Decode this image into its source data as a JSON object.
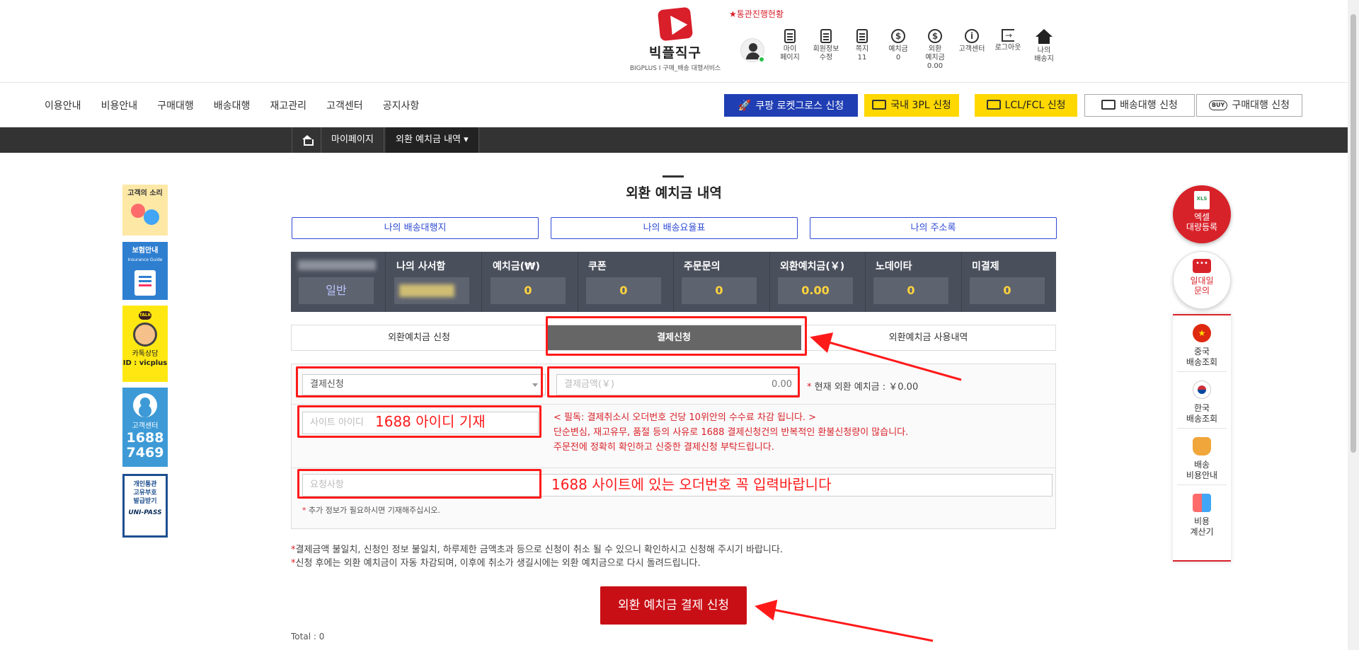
{
  "brand": {
    "name": "빅플직구",
    "tagline": "BIGPLUS I 구매_배송 대행서비스",
    "accent_color": "#d81f2a"
  },
  "header": {
    "customs_link": "★통관진행현황",
    "utility_nav": [
      {
        "label": "마이\n페이지",
        "icon": "id-card-icon"
      },
      {
        "label": "회원정보\n수정",
        "icon": "id-card-icon"
      },
      {
        "label": "쪽지\n11",
        "icon": "document-icon"
      },
      {
        "label": "예치금\n0",
        "icon": "dollar-icon"
      },
      {
        "label": "외환\n예치금\n0.00",
        "icon": "dollar-icon"
      },
      {
        "label": "고객센터",
        "icon": "info-icon"
      },
      {
        "label": "로그아웃",
        "icon": "logout-icon"
      },
      {
        "label": "나의\n배송지",
        "icon": "home-icon"
      }
    ]
  },
  "gnb": {
    "items": [
      "이용안내",
      "비용안내",
      "구매대행",
      "배송대행",
      "재고관리",
      "고객센터",
      "공지사항"
    ]
  },
  "service_buttons": [
    {
      "label": "쿠팡 로켓그로스 신청",
      "style": "blue"
    },
    {
      "label": "국내 3PL 신청",
      "style": "yellow"
    },
    {
      "label": "LCL/FCL 신청",
      "style": "yellow"
    },
    {
      "label": "배송대행 신청",
      "style": "white"
    },
    {
      "label": "구매대행 신청",
      "style": "white"
    }
  ],
  "breadcrumb": {
    "items": [
      "마이페이지",
      "외환 예치금 내역 ▾"
    ]
  },
  "left_banners": {
    "voice": "고객의 소리",
    "insurance": "보험안내",
    "insurance_sub": "Insurance Guide",
    "kakao_talk": "TALK",
    "kakao_label": "카톡상담",
    "kakao_id": "ID : vicplus",
    "cs_label": "고객센터",
    "cs_tel": "1688\n7469",
    "unipass_text": "개인통관\n고유부호\n발급받기",
    "unipass_brand": "UNI-PASS"
  },
  "right_float": {
    "excel": "엑셀\n대량등록",
    "excel_badge": "XLS",
    "chat": "일대일\n문의",
    "chat_badge": "•••",
    "china_badge": "★",
    "items": [
      {
        "label": "중국\n배송조회",
        "icon": "china-flag-icon"
      },
      {
        "label": "한국\n배송조회",
        "icon": "korea-flag-icon"
      },
      {
        "label": "배송\n비용안내",
        "icon": "money-bag-icon"
      },
      {
        "label": "비용\n계산기",
        "icon": "calculator-icon"
      }
    ]
  },
  "main": {
    "title": "외환 예치금 내역",
    "quick_links": [
      "나의 배송대행지",
      "나의 배송요율표",
      "나의 주소록"
    ],
    "summary": {
      "grade": "일반",
      "columns": [
        {
          "label": "나의 사서함",
          "value": ""
        },
        {
          "label": "예치금(₩)",
          "value": "0"
        },
        {
          "label": "쿠폰",
          "value": "0"
        },
        {
          "label": "주문문의",
          "value": "0"
        },
        {
          "label": "외환예치금(￥)",
          "value": "0.00"
        },
        {
          "label": "노데이타",
          "value": "0"
        },
        {
          "label": "미결제",
          "value": "0"
        }
      ]
    },
    "tabs": [
      "외환예치금 신청",
      "결제신청",
      "외환예치금 사용내역"
    ],
    "active_tab": 1,
    "form": {
      "type_select": "결제신청",
      "amount_placeholder": "결제금액(￥)",
      "amount_value": "0.00",
      "current_balance": "현재 외환 예치금 : ￥0.00",
      "site_id_placeholder": "사이트 아이디",
      "notice": [
        "< 필독: 결제취소시 오더번호 건당 10위안의 수수료 차감 됩니다. >",
        "단순변심, 재고유무, 품절 등의 사유로 1688 결제신청건의 반복적인 환불신청량이 많습니다.",
        "주문전에 정확히 확인하고 신중한 결제신청 부탁드립니다."
      ],
      "request_placeholder": "요청사항",
      "request_help": "추가 정보가 필요하시면 기재해주십시오."
    },
    "annotations": {
      "site_id": "1688 아이디 기재",
      "order_no": "1688 사이트에 있는 오더번호 꼭 입력바랍니다",
      "color": "#ff1a1a"
    },
    "warnings": [
      "결제금액 불일치, 신청인 정보 불일치, 하루제한 금액초과 등으로 신청이 취소 될 수 있으니 확인하시고 신청해 주시기 바랍니다.",
      "신청 후에는 외환 예치금이 자동 차감되며, 이후에 취소가 생길시에는 외환 예치금으로 다시 돌려드립니다."
    ],
    "submit_label": "외환 예치금 결제 신청",
    "total": "Total : 0"
  }
}
